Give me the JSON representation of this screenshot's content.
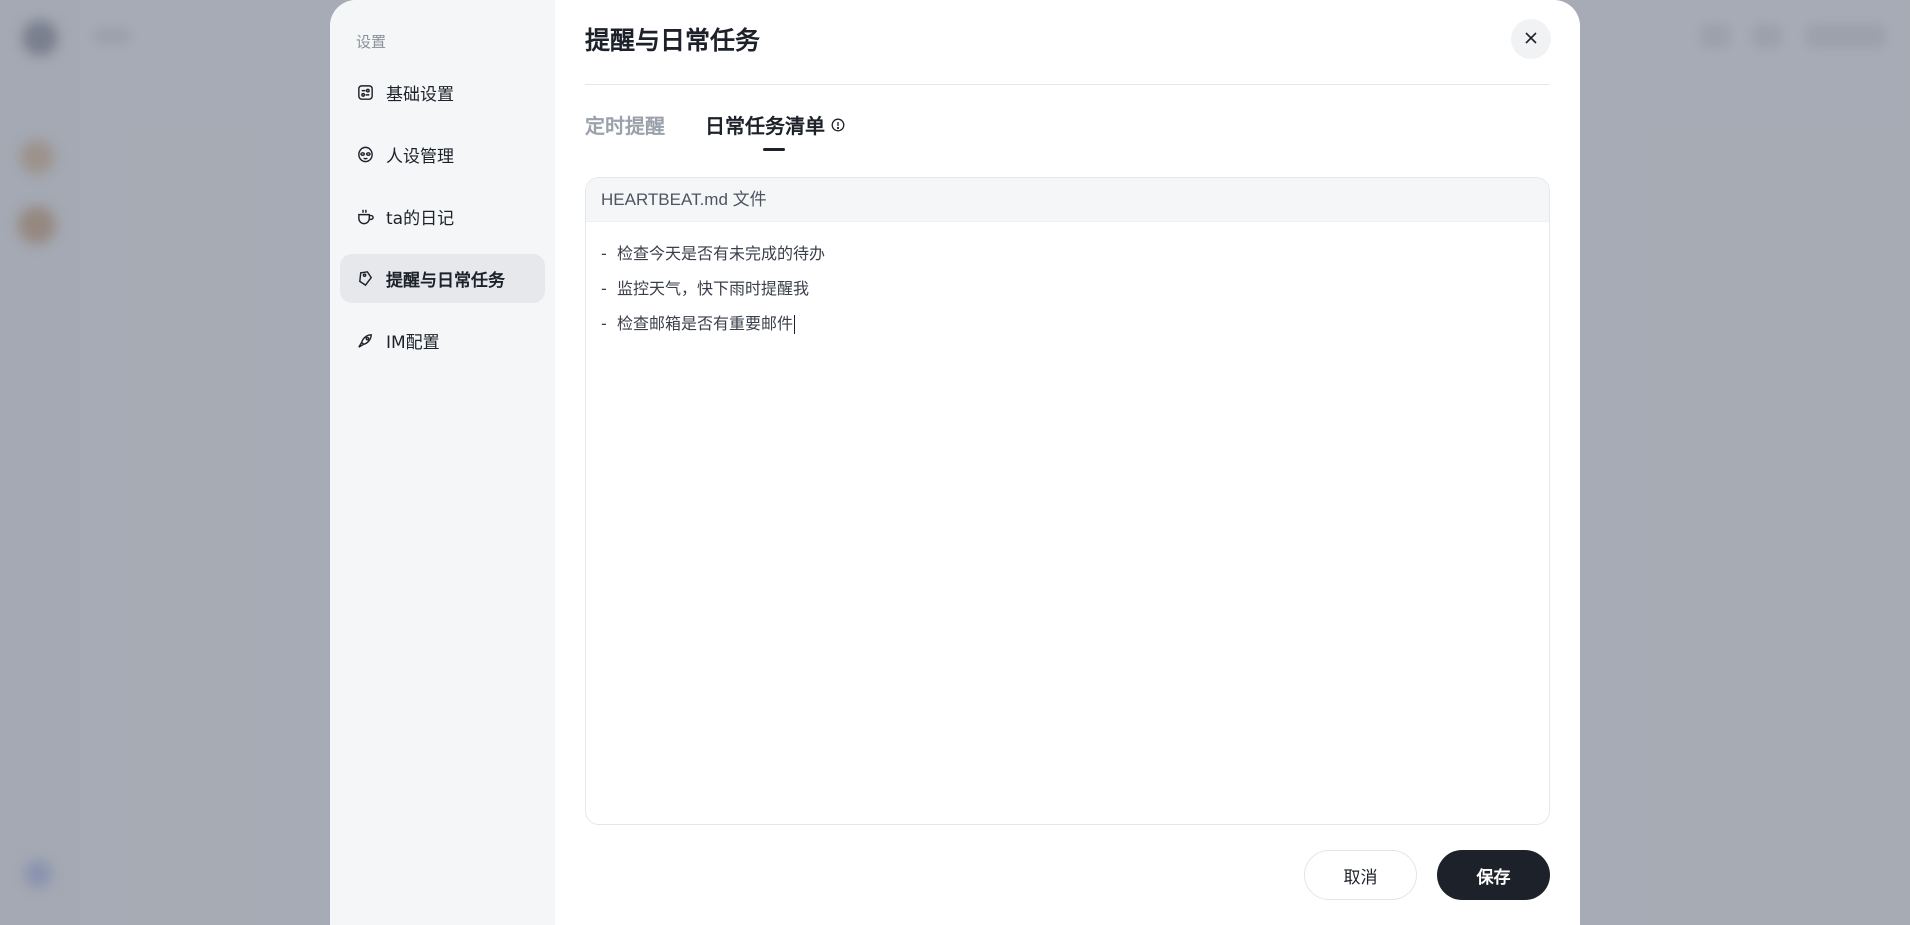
{
  "settings": {
    "heading": "设置",
    "nav": [
      {
        "label": "基础设置",
        "icon": "basic-settings-icon"
      },
      {
        "label": "人设管理",
        "icon": "alien-face-icon"
      },
      {
        "label": "ta的日记",
        "icon": "coffee-cup-icon"
      },
      {
        "label": "提醒与日常任务",
        "icon": "tag-icon",
        "active": true
      },
      {
        "label": "IM配置",
        "icon": "rocket-icon"
      }
    ]
  },
  "main": {
    "title": "提醒与日常任务",
    "tabs": [
      {
        "label": "定时提醒",
        "active": false
      },
      {
        "label": "日常任务清单",
        "active": true
      }
    ]
  },
  "editor": {
    "file_label": "HEARTBEAT.md 文件",
    "lines": [
      "-  检查今天是否有未完成的待办",
      "-  监控天气，快下雨时提醒我",
      "-  检查邮箱是否有重要邮件"
    ]
  },
  "footer": {
    "cancel_label": "取消",
    "save_label": "保存"
  },
  "colors": {
    "primary_button": "#1d2129",
    "overlay": "#787e8c",
    "sidebar_bg": "#f5f6f8"
  }
}
